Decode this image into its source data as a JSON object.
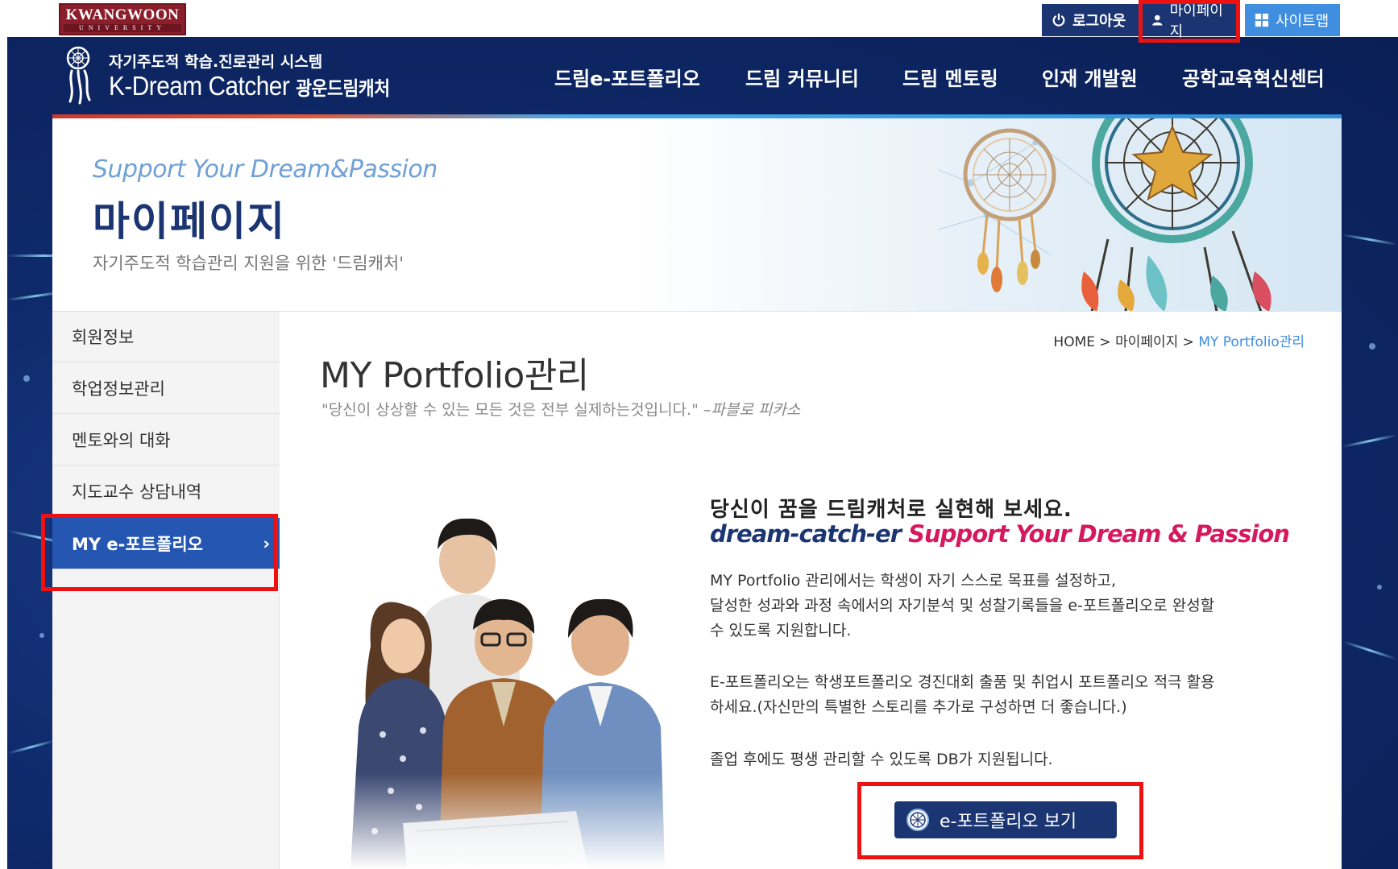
{
  "university": {
    "name": "KWANGWOON",
    "sub": "UNIVERSITY"
  },
  "util_nav": {
    "logout": "로그아웃",
    "mypage": "마이페이지",
    "sitemap": "사이트맵"
  },
  "header": {
    "system_title": "자기주도적 학습.진로관리 시스템",
    "brand": "K-Dream Catcher",
    "brand_ko": "광운드림캐처",
    "nav": [
      "드림e-포트폴리오",
      "드림 커뮤니티",
      "드림 멘토링",
      "인재 개발원",
      "공학교육혁신센터"
    ]
  },
  "hero": {
    "subtitle": "Support Your Dream&Passion",
    "title": "마이페이지",
    "description": "자기주도적 학습관리 지원을 위한 '드림캐처'"
  },
  "sidebar": {
    "items": [
      {
        "label": "회원정보"
      },
      {
        "label": "학업정보관리"
      },
      {
        "label": "멘토와의 대화"
      },
      {
        "label": "지도교수 상담내역"
      },
      {
        "label": "MY e-포트폴리오",
        "arrow": "›"
      }
    ]
  },
  "breadcrumb": {
    "home": "HOME",
    "sep": ">",
    "level1": "마이페이지",
    "current": "MY Portfolio관리"
  },
  "main": {
    "title": "MY Portfolio관리",
    "quote": "\"당신이 상상할 수 있는 모든 것은 전부 실제하는것입니다.\"",
    "quote_author": "–파블로 피카소",
    "lead": "당신이 꿈을 드림캐처로 실현해 보세요.",
    "slogan_a": "dream-catch-er",
    "slogan_b": "Support Your Dream & Passion",
    "para1_l1": "MY Portfolio 관리에서는 학생이 자기 스스로 목표를 설정하고,",
    "para1_l2": "달성한 성과와 과정 속에서의 자기분석 및 성찰기록들을 e-포트폴리오로 완성할",
    "para1_l3": "수 있도록 지원합니다.",
    "para2_l1": "E-포트폴리오는 학생포트폴리오 경진대회 출품 및 취업시 포트폴리오 적극 활용",
    "para2_l2": "하세요.(자신만의 특별한 스토리를 추가로 구성하면 더 좋습니다.)",
    "para3": "졸업 후에도 평생 관리할 수 있도록 DB가 지원됩니다.",
    "cta": "e-포트폴리오 보기"
  },
  "colors": {
    "navy": "#1b3573",
    "accent_blue": "#2557b2",
    "sitemap_blue": "#3f8ee0",
    "highlight_red": "#ee1111",
    "brand_maroon": "#8b1e2b",
    "slogan_pink": "#d6185e"
  },
  "icons": {
    "logout": "power-icon",
    "mypage": "user-icon",
    "sitemap": "grid-icon",
    "cta": "globe-icon",
    "brand": "dreamcatcher-icon"
  }
}
